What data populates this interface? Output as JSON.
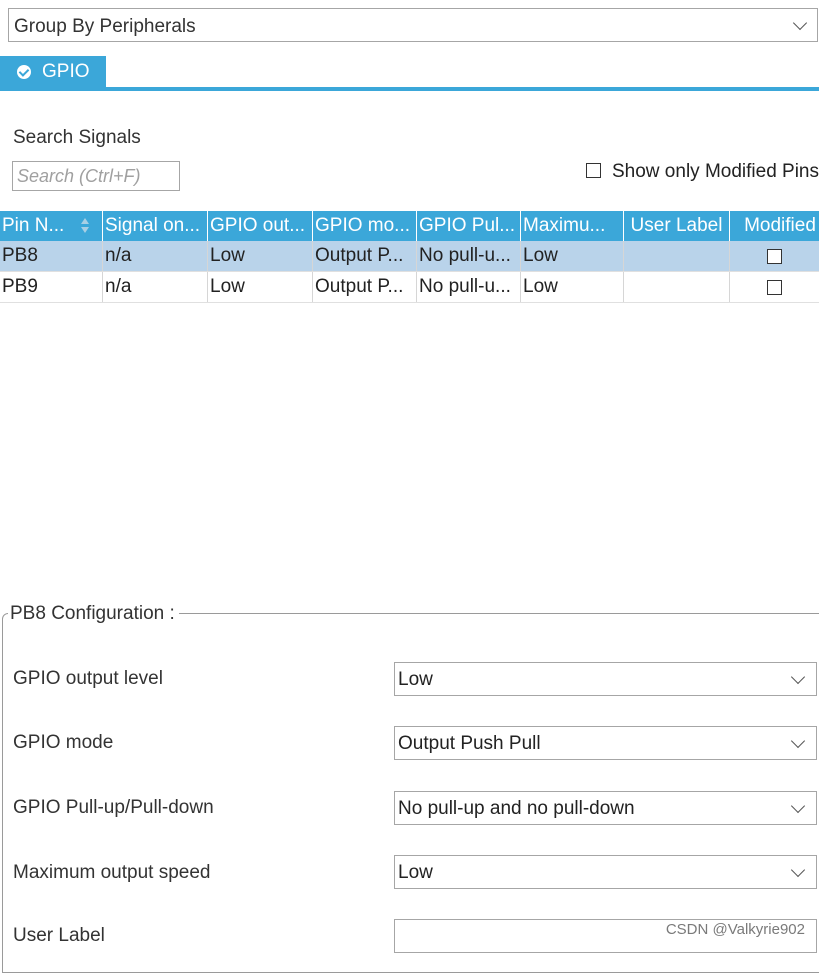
{
  "group_by": {
    "value": "Group By Peripherals"
  },
  "tab": {
    "label": "GPIO",
    "icon": "check-circle-icon"
  },
  "search": {
    "title": "Search Signals",
    "placeholder": "Search (Ctrl+F)"
  },
  "show_modified": {
    "label": "Show only Modified Pins",
    "checked": false
  },
  "table": {
    "columns": [
      "Pin N...",
      "Signal on...",
      "GPIO out...",
      "GPIO mo...",
      "GPIO Pul...",
      "Maximu...",
      "User Label",
      "Modified"
    ],
    "rows": [
      {
        "pin": "PB8",
        "signal": "n/a",
        "output": "Low",
        "mode": "Output P...",
        "pull": "No pull-u...",
        "speed": "Low",
        "label": "",
        "modified": false,
        "selected": true
      },
      {
        "pin": "PB9",
        "signal": "n/a",
        "output": "Low",
        "mode": "Output P...",
        "pull": "No pull-u...",
        "speed": "Low",
        "label": "",
        "modified": false,
        "selected": false
      }
    ]
  },
  "config": {
    "title": "PB8 Configuration :",
    "output_level": {
      "label": "GPIO output level",
      "value": "Low"
    },
    "mode": {
      "label": "GPIO mode",
      "value": "Output Push Pull"
    },
    "pull": {
      "label": "GPIO Pull-up/Pull-down",
      "value": "No pull-up and no pull-down"
    },
    "speed": {
      "label": "Maximum output speed",
      "value": "Low"
    },
    "user_label": {
      "label": "User Label",
      "value": ""
    }
  },
  "watermark": "CSDN @Valkyrie902",
  "colors": {
    "accent": "#3ba7d9",
    "selected_row": "#b9d3ea"
  }
}
